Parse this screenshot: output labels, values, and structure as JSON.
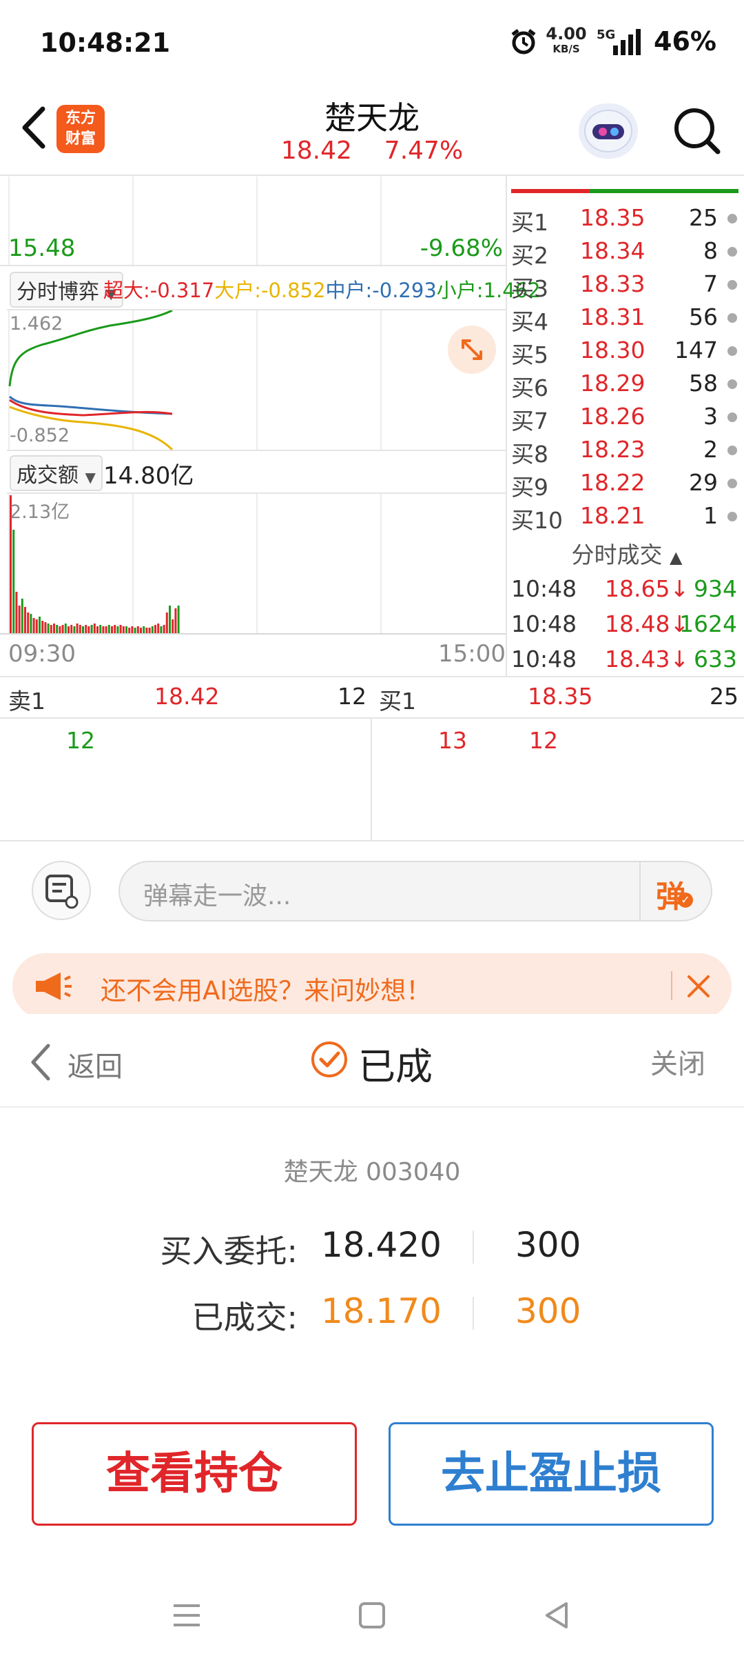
{
  "status_bar": {
    "time": "10:48:21",
    "net_speed": "4.00",
    "net_unit": "KB/S",
    "network": "5G",
    "battery": "46%"
  },
  "header": {
    "logo_line1": "东方",
    "logo_line2": "财富",
    "stock_name": "楚天龙",
    "price": "18.42",
    "change_pct": "7.47%"
  },
  "chart": {
    "low_price": "15.48",
    "low_pct": "-9.68%",
    "flow_dropdown": "分时博弈",
    "flow_super": "超大:-0.317",
    "flow_large": "大户:-0.852",
    "flow_mid": "中户:-0.293",
    "flow_small": "小户:1.462",
    "flow_max": "1.462",
    "flow_min": "-0.852",
    "volume_dropdown": "成交额",
    "volume_total": "14.80亿",
    "volume_max": "2.13亿",
    "time_start": "09:30",
    "time_end": "15:00",
    "colors": {
      "super": "#e0262a",
      "large": "#e8b400",
      "mid": "#2f6fb2",
      "small": "#1a9a1a"
    }
  },
  "order_book": {
    "bids": [
      {
        "label": "买1",
        "price": "18.35",
        "vol": "25"
      },
      {
        "label": "买2",
        "price": "18.34",
        "vol": "8"
      },
      {
        "label": "买3",
        "price": "18.33",
        "vol": "7"
      },
      {
        "label": "买4",
        "price": "18.31",
        "vol": "56"
      },
      {
        "label": "买5",
        "price": "18.30",
        "vol": "147"
      },
      {
        "label": "买6",
        "price": "18.29",
        "vol": "58"
      },
      {
        "label": "买7",
        "price": "18.26",
        "vol": "3"
      },
      {
        "label": "买8",
        "price": "18.23",
        "vol": "2"
      },
      {
        "label": "买9",
        "price": "18.22",
        "vol": "29"
      },
      {
        "label": "买10",
        "price": "18.21",
        "vol": "1"
      }
    ],
    "trades_title": "分时成交",
    "trades": [
      {
        "time": "10:48",
        "price": "18.65↓",
        "vol": "934"
      },
      {
        "time": "10:48",
        "price": "18.48↓",
        "vol": "1624"
      },
      {
        "time": "10:48",
        "price": "18.43↓",
        "vol": "633"
      }
    ]
  },
  "queue": {
    "sell_label": "卖1",
    "sell_price": "18.42",
    "sell_vol": "12",
    "sell_orders": [
      "12"
    ],
    "buy_label": "买1",
    "buy_price": "18.35",
    "buy_vol": "25",
    "buy_orders": [
      "13",
      "12"
    ]
  },
  "danmaku": {
    "placeholder": "弹幕走一波...",
    "send_label": "弹"
  },
  "banner": {
    "text": "还不会用AI选股？来问妙想！"
  },
  "sheet": {
    "back_label": "返回",
    "status_label": "已成",
    "close_label": "关闭",
    "stock_line": "楚天龙 003040",
    "order_label": "买入委托:",
    "order_price": "18.420",
    "order_qty": "300",
    "filled_label": "已成交:",
    "filled_price": "18.170",
    "filled_qty": "300",
    "btn_positions": "查看持仓",
    "btn_stop": "去止盈止损"
  }
}
